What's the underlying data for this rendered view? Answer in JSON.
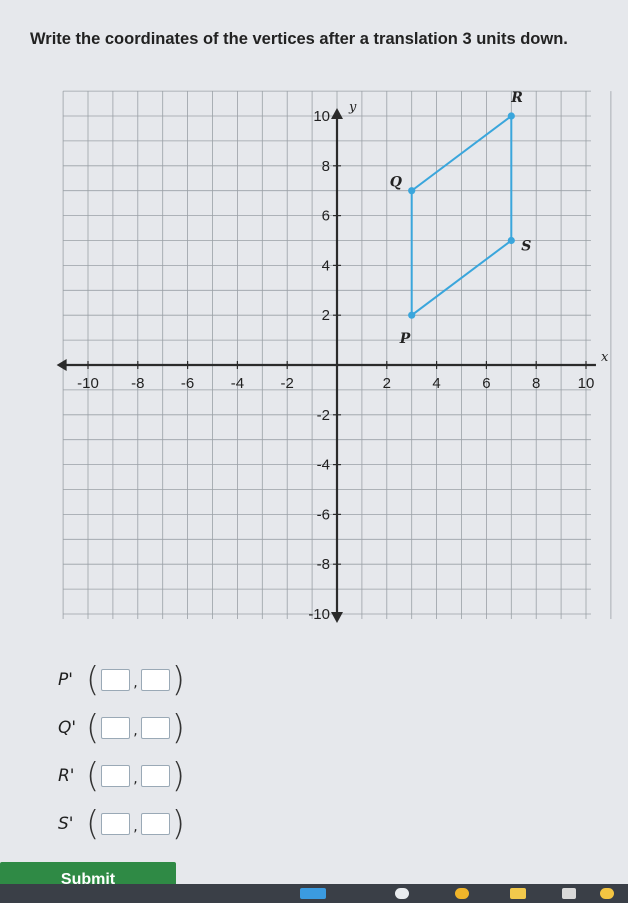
{
  "question": "Write the coordinates of the vertices after a translation 3 units down.",
  "chart_data": {
    "type": "scatter",
    "xlabel": "x",
    "ylabel": "y",
    "xlim": [
      -10,
      10
    ],
    "ylim": [
      -10,
      10
    ],
    "grid": true,
    "x_ticks": [
      -10,
      -8,
      -6,
      -4,
      -2,
      2,
      4,
      6,
      8,
      10
    ],
    "y_ticks": [
      -10,
      -8,
      -6,
      -4,
      -2,
      2,
      4,
      6,
      8,
      10
    ],
    "points": [
      {
        "label": "P",
        "x": 3,
        "y": 2
      },
      {
        "label": "Q",
        "x": 3,
        "y": 7
      },
      {
        "label": "R",
        "x": 7,
        "y": 10
      },
      {
        "label": "S",
        "x": 7,
        "y": 5
      }
    ],
    "polygon_order": [
      "P",
      "Q",
      "R",
      "S"
    ],
    "shape_color": "#3aa6dc"
  },
  "answers": [
    {
      "label": "P'",
      "x": "",
      "y": ""
    },
    {
      "label": "Q'",
      "x": "",
      "y": ""
    },
    {
      "label": "R'",
      "x": "",
      "y": ""
    },
    {
      "label": "S'",
      "x": "",
      "y": ""
    }
  ],
  "submit_label": "Submit"
}
